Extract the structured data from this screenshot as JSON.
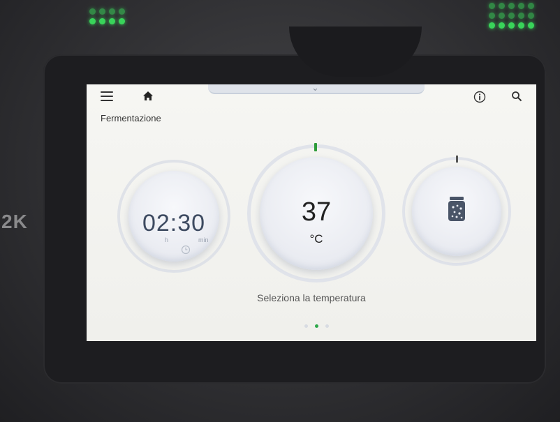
{
  "screen": {
    "title": "Fermentazione",
    "hint": "Seleziona la temperatura"
  },
  "timer": {
    "value": "02:30",
    "unit_hours": "h",
    "unit_minutes": "min"
  },
  "temperature": {
    "value": "37",
    "unit": "°C"
  },
  "pager": {
    "pages": 3,
    "active_index": 1
  },
  "icons": [
    "menu-icon",
    "home-icon",
    "info-icon",
    "search-icon",
    "chevron-down-icon",
    "clock-icon",
    "jar-icon"
  ],
  "colors": {
    "accent": "#2ca84a",
    "led": "#39d45a"
  }
}
